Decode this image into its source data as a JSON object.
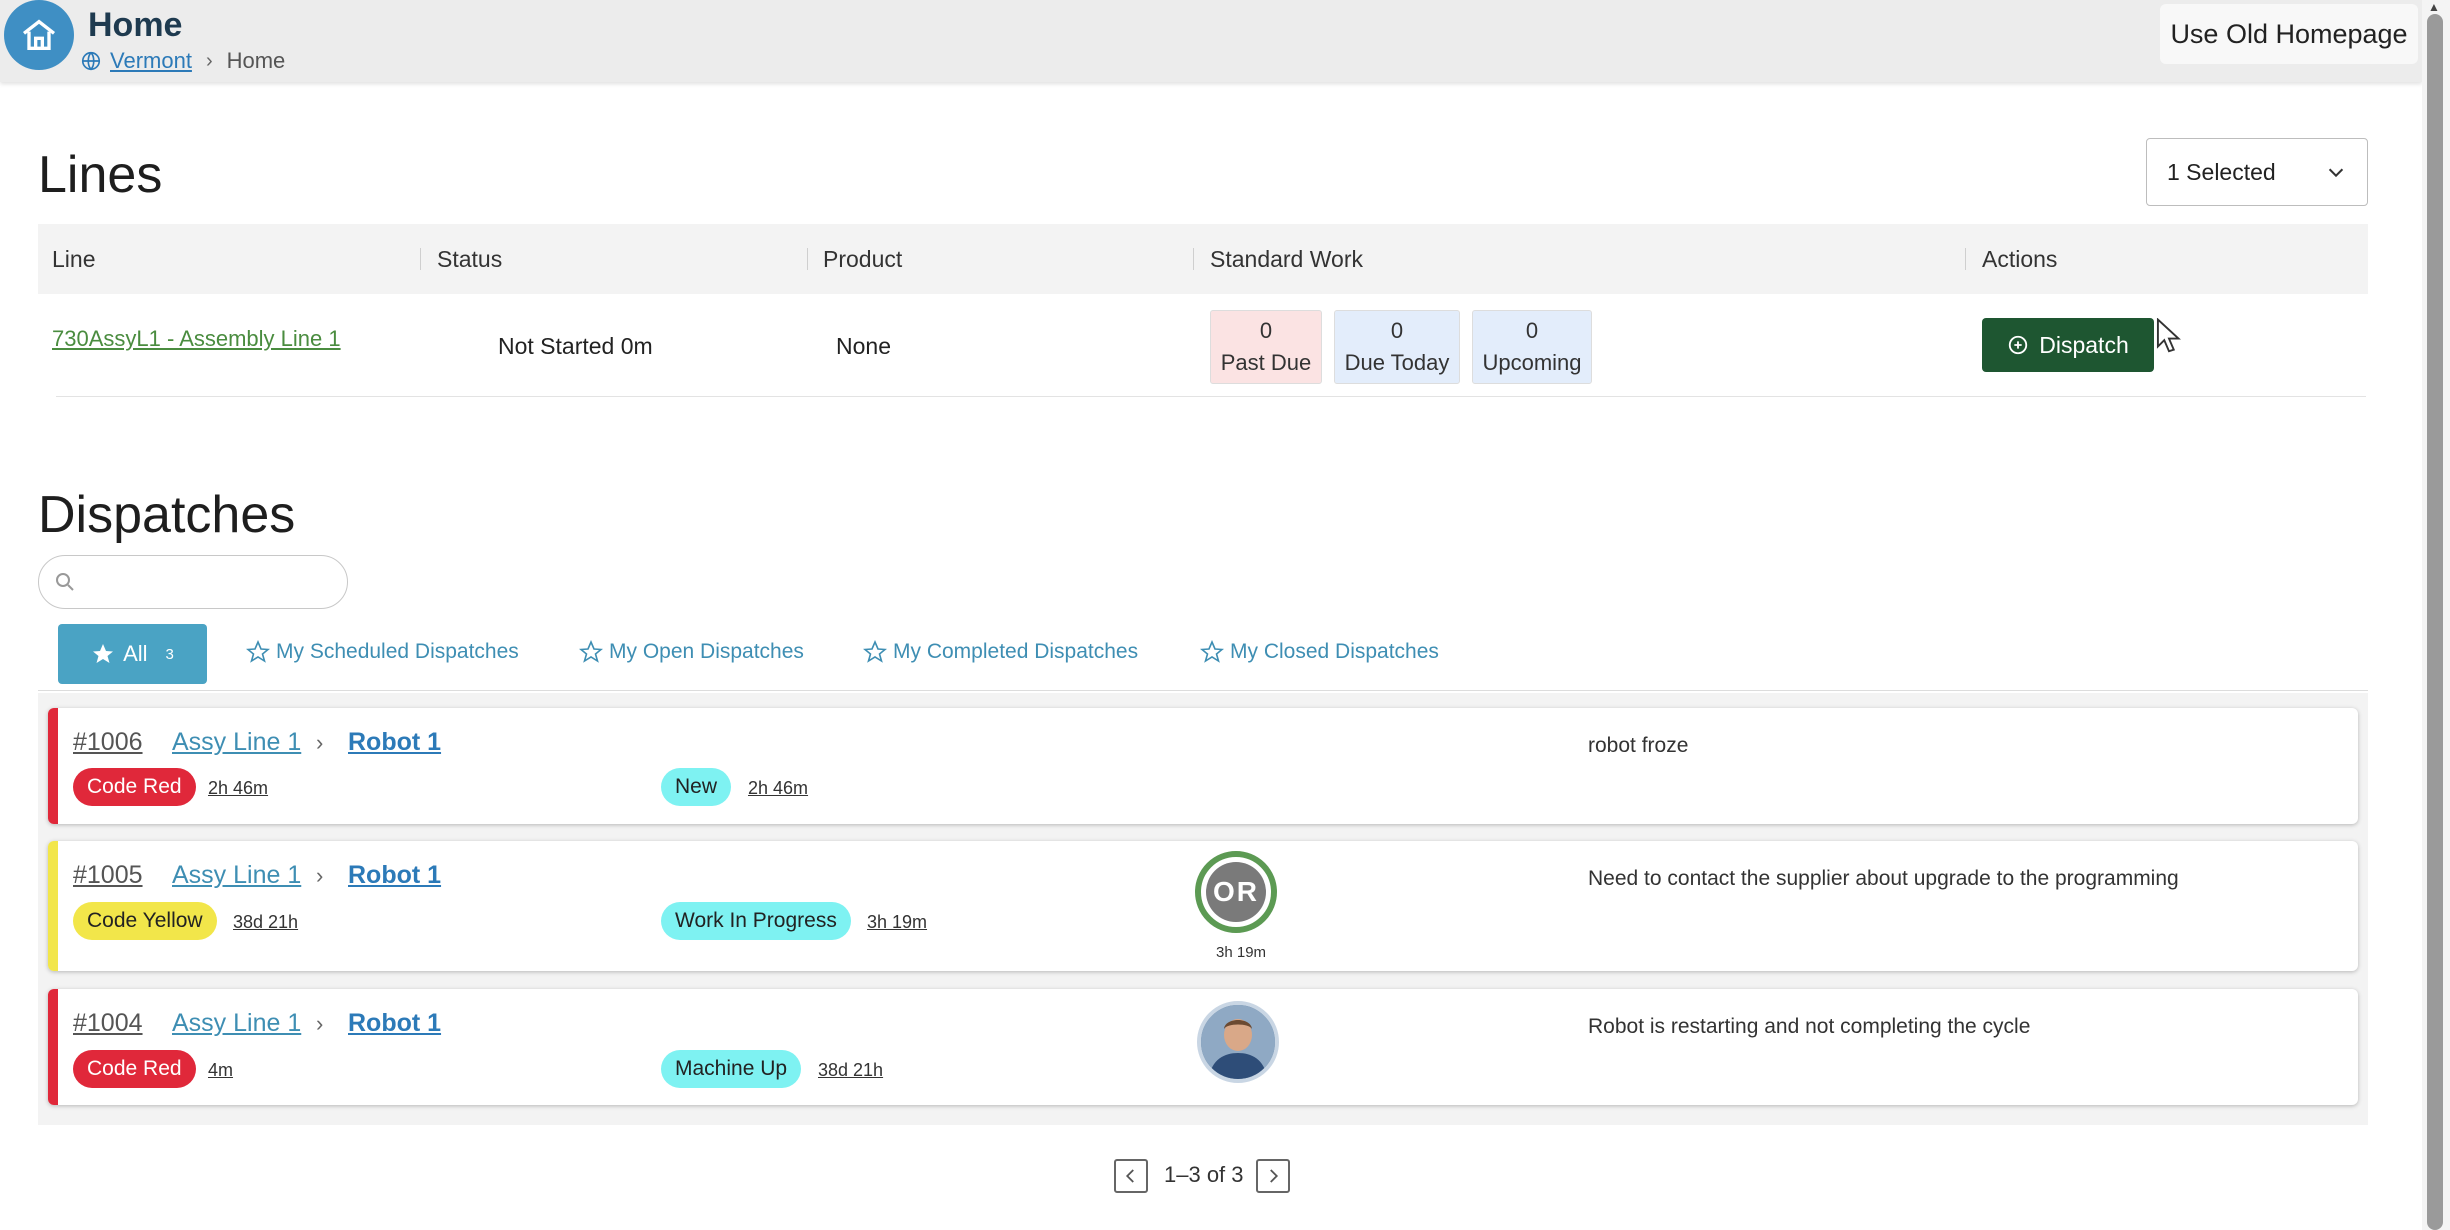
{
  "header": {
    "title": "Home",
    "breadcrumb": [
      {
        "label": "Vermont"
      },
      {
        "label": "Home"
      }
    ],
    "old_homepage_button": "Use Old Homepage"
  },
  "lines": {
    "title": "Lines",
    "filter_value": "1 Selected",
    "columns": [
      "Line",
      "Status",
      "Product",
      "Standard Work",
      "Actions"
    ],
    "rows": [
      {
        "line": "730AssyL1 - Assembly Line 1",
        "status": "Not Started 0m",
        "product": "None",
        "standard_work": {
          "past_due": {
            "count": "0",
            "label": "Past Due"
          },
          "due_today": {
            "count": "0",
            "label": "Due Today"
          },
          "upcoming": {
            "count": "0",
            "label": "Upcoming"
          }
        },
        "action": "Dispatch"
      }
    ]
  },
  "dispatches": {
    "title": "Dispatches",
    "search_value": "",
    "tabs": {
      "all": {
        "label": "All",
        "count": "3"
      },
      "scheduled": "My Scheduled Dispatches",
      "open": "My Open Dispatches",
      "completed": "My Completed Dispatches",
      "closed": "My Closed Dispatches"
    },
    "items": [
      {
        "number": "#1006",
        "line": "Assy Line 1",
        "asset": "Robot 1",
        "code": "Code Red",
        "code_age": "2h 46m",
        "status": "New",
        "status_age": "2h 46m",
        "description": "robot froze"
      },
      {
        "number": "#1005",
        "line": "Assy Line 1",
        "asset": "Robot 1",
        "code": "Code Yellow",
        "code_age": "38d 21h",
        "status": "Work In Progress",
        "status_age": "3h 19m",
        "assignee_initials": "OR",
        "assignee_time": "3h 19m",
        "description": "Need to contact the supplier about upgrade to the programming"
      },
      {
        "number": "#1004",
        "line": "Assy Line 1",
        "asset": "Robot 1",
        "code": "Code Red",
        "code_age": "4m",
        "status": "Machine Up",
        "status_age": "38d 21h",
        "description": "Robot is restarting and not completing the cycle"
      }
    ],
    "pagination": "1–3 of 3"
  },
  "colors": {
    "brand_blue": "#3f8fc4",
    "dispatch_green": "#1e5631",
    "code_red": "#e0283a",
    "code_yellow": "#f2e64a",
    "status_cyan": "#7ef2f2",
    "tab_active": "#4aa3c4"
  },
  "icons": [
    "home-icon",
    "globe-icon",
    "chevron-down-icon",
    "plus-circle-icon",
    "search-icon",
    "star-icon",
    "chevron-left-icon",
    "chevron-right-icon",
    "mouse-cursor-icon"
  ]
}
